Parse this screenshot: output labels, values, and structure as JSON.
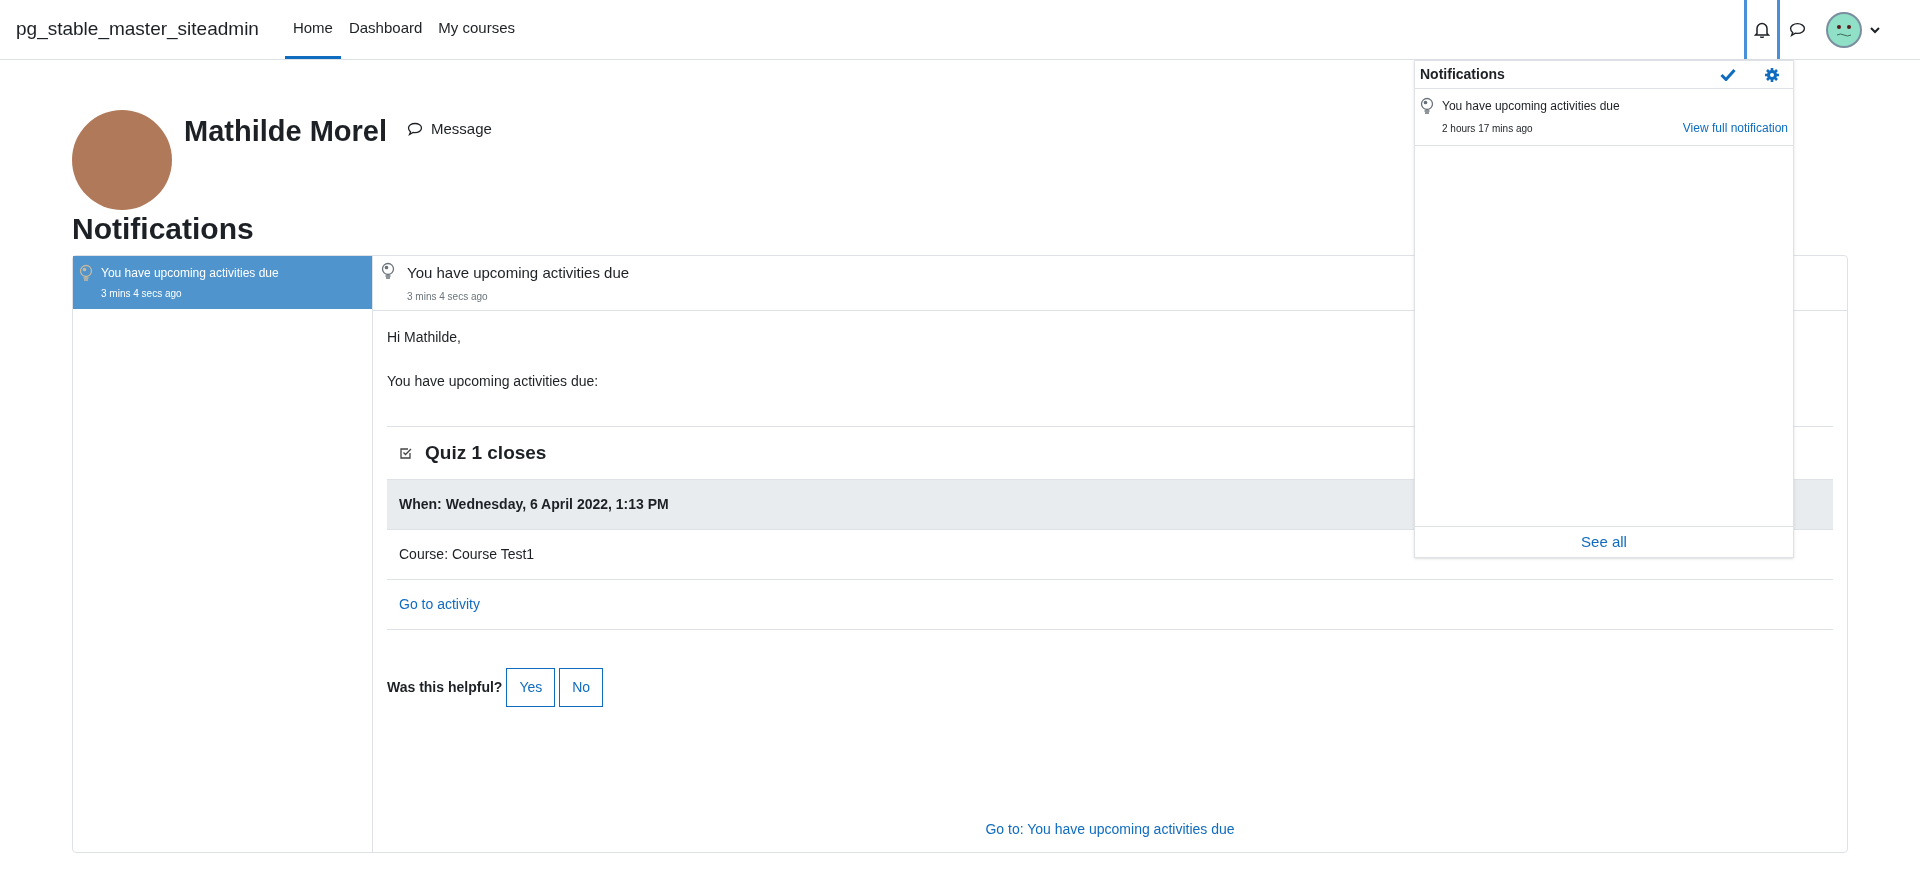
{
  "navbar": {
    "site_name": "pg_stable_master_siteadmin",
    "links": [
      {
        "label": "Home",
        "selected": true
      },
      {
        "label": "Dashboard",
        "selected": false
      },
      {
        "label": "My courses",
        "selected": false
      }
    ],
    "notifications_open": true
  },
  "profile": {
    "name": "Mathilde Morel",
    "message_label": "Message"
  },
  "page_title": "Notifications",
  "notification_list": [
    {
      "title": "You have upcoming activities due",
      "time": "3 mins 4 secs ago",
      "selected": true
    }
  ],
  "detail": {
    "title": "You have upcoming activities due",
    "time": "3 mins 4 secs ago",
    "greeting": "Hi Mathilde,",
    "intro": "You have upcoming activities due:",
    "event": {
      "title": "Quiz 1 closes",
      "when": "When: Wednesday, 6 April 2022, 1:13 PM",
      "course": "Course: Course Test1",
      "link": "Go to activity"
    },
    "feedback": {
      "question": "Was this helpful?",
      "buttons": [
        "Yes",
        "No"
      ]
    },
    "footer_link": "Go to: You have upcoming activities due"
  },
  "popover": {
    "title": "Notifications",
    "items": [
      {
        "title": "You have upcoming activities due",
        "time": "2 hours 17 mins ago",
        "link": "View full notification"
      }
    ],
    "see_all": "See all"
  }
}
